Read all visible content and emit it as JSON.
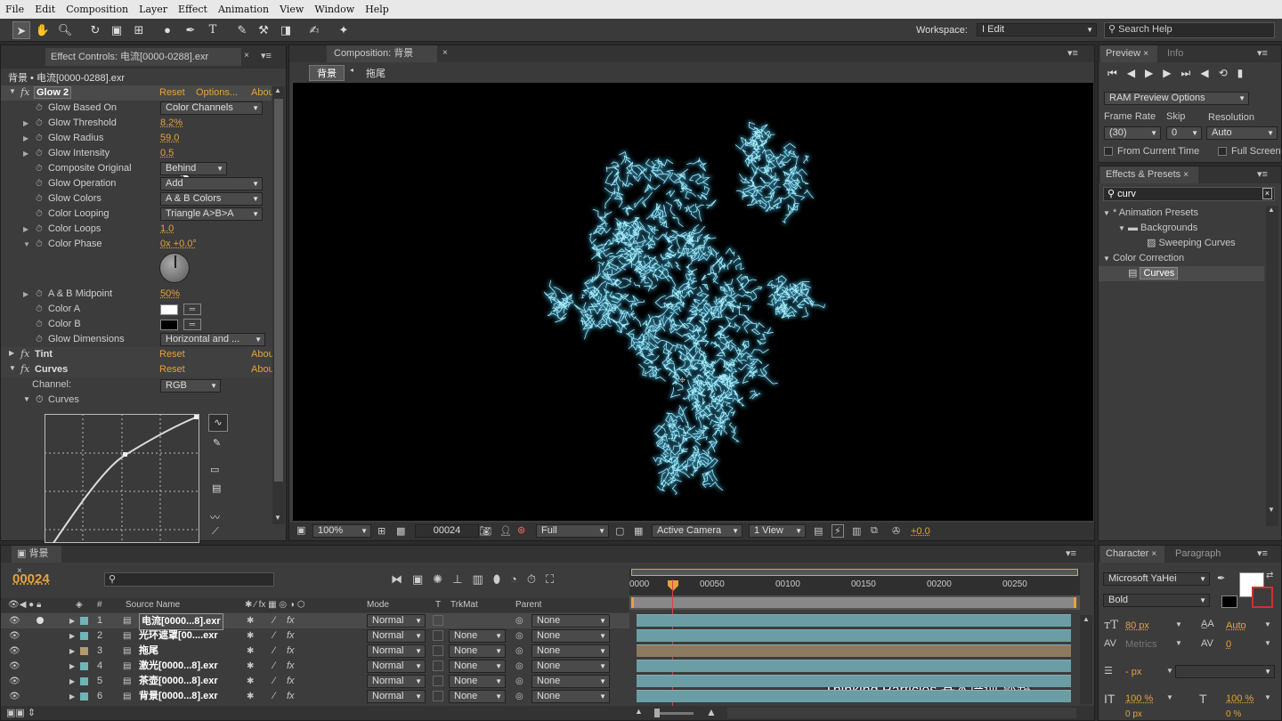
{
  "menu": [
    "File",
    "Edit",
    "Composition",
    "Layer",
    "Effect",
    "Animation",
    "View",
    "Window",
    "Help"
  ],
  "workspace": {
    "label": "Workspace:",
    "value": "I Edit"
  },
  "search_help": "Search Help",
  "effect_controls": {
    "tab": "Effect Controls: 电流[0000-0288].exr",
    "breadcrumb": "背景 • 电流[0000-0288].exr",
    "glow": {
      "name": "Glow 2",
      "reset": "Reset",
      "options": "Options...",
      "about": "Abou"
    },
    "props": [
      {
        "name": "Glow Based On",
        "dd": "Color Channels"
      },
      {
        "name": "Glow Threshold",
        "val": "8.2%"
      },
      {
        "name": "Glow Radius",
        "val": "59.0"
      },
      {
        "name": "Glow Intensity",
        "val": "0.5"
      },
      {
        "name": "Composite Original",
        "dd": "Behind"
      },
      {
        "name": "Glow Operation",
        "dd": "Add"
      },
      {
        "name": "Glow Colors",
        "dd": "A & B Colors"
      },
      {
        "name": "Color Looping",
        "dd": "Triangle A>B>A"
      },
      {
        "name": "Color Loops",
        "val": "1.0"
      },
      {
        "name": "Color Phase",
        "val": "0x +0.0°"
      }
    ],
    "props2": [
      {
        "name": "A & B Midpoint",
        "val": "50%"
      },
      {
        "name": "Color A"
      },
      {
        "name": "Color B"
      },
      {
        "name": "Glow Dimensions",
        "dd": "Horizontal and ..."
      }
    ],
    "tint": {
      "name": "Tint",
      "reset": "Reset",
      "about": "Abou"
    },
    "curves": {
      "name": "Curves",
      "reset": "Reset",
      "about": "Abou",
      "channel_label": "Channel:",
      "channel": "RGB",
      "curves_label": "Curves"
    }
  },
  "composition": {
    "tab": "Composition: 背景",
    "crumb1": "背景",
    "crumb2": "拖尾",
    "zoom": "100%",
    "timecode": "00024",
    "resolution": "Full",
    "camera": "Active Camera",
    "views": "1 View",
    "exposure": "+0.0"
  },
  "preview": {
    "tab": "Preview",
    "info_tab": "Info",
    "ram": "RAM Preview Options",
    "frame_rate_label": "Frame Rate",
    "skip_label": "Skip",
    "resolution_label": "Resolution",
    "frame_rate": "(30)",
    "skip": "0",
    "resolution": "Auto",
    "from_current": "From Current Time",
    "full_screen": "Full Screen"
  },
  "effects_presets": {
    "tab": "Effects & Presets",
    "search": "curv",
    "tree": [
      "* Animation Presets",
      "Backgrounds",
      "Sweeping Curves",
      "Color Correction",
      "Curves"
    ]
  },
  "timeline": {
    "tab": "背景",
    "timecode": "00024",
    "cols": {
      "source": "Source Name",
      "mode": "Mode",
      "t": "T",
      "trkmat": "TrkMat",
      "parent": "Parent"
    },
    "ruler": [
      "0000",
      "00050",
      "00100",
      "00150",
      "00200",
      "00250"
    ],
    "layers": [
      {
        "num": "1",
        "name": "电流[0000...8].exr",
        "mode": "Normal",
        "trk": "",
        "parent": "None",
        "color": "#6fb5b8"
      },
      {
        "num": "2",
        "name": "光环遮罩[00....exr",
        "mode": "Normal",
        "trk": "None",
        "parent": "None",
        "color": "#6fb5b8"
      },
      {
        "num": "3",
        "name": "拖尾",
        "mode": "Normal",
        "trk": "None",
        "parent": "None",
        "color": "#b59a6f"
      },
      {
        "num": "4",
        "name": "激光[0000...8].exr",
        "mode": "Normal",
        "trk": "None",
        "parent": "None",
        "color": "#6fb5b8"
      },
      {
        "num": "5",
        "name": "茶壶[0000...8].exr",
        "mode": "Normal",
        "trk": "None",
        "parent": "None",
        "color": "#6fb5b8"
      },
      {
        "num": "6",
        "name": "背景[0000...8].exr",
        "mode": "Normal",
        "trk": "None",
        "parent": "None",
        "color": "#6fb5b8"
      }
    ]
  },
  "character": {
    "tab": "Character",
    "para_tab": "Paragraph",
    "font": "Microsoft YaHei",
    "style": "Bold",
    "size": "80 px",
    "leading": "Auto",
    "kern": "Metrics",
    "track": "0",
    "stroke": "- px",
    "vscale": "100 %",
    "hscale": "100 %",
    "baseline": "0 px",
    "tsume": "0 %"
  },
  "watermark": "Thinking Particles 基本培训-郭超"
}
